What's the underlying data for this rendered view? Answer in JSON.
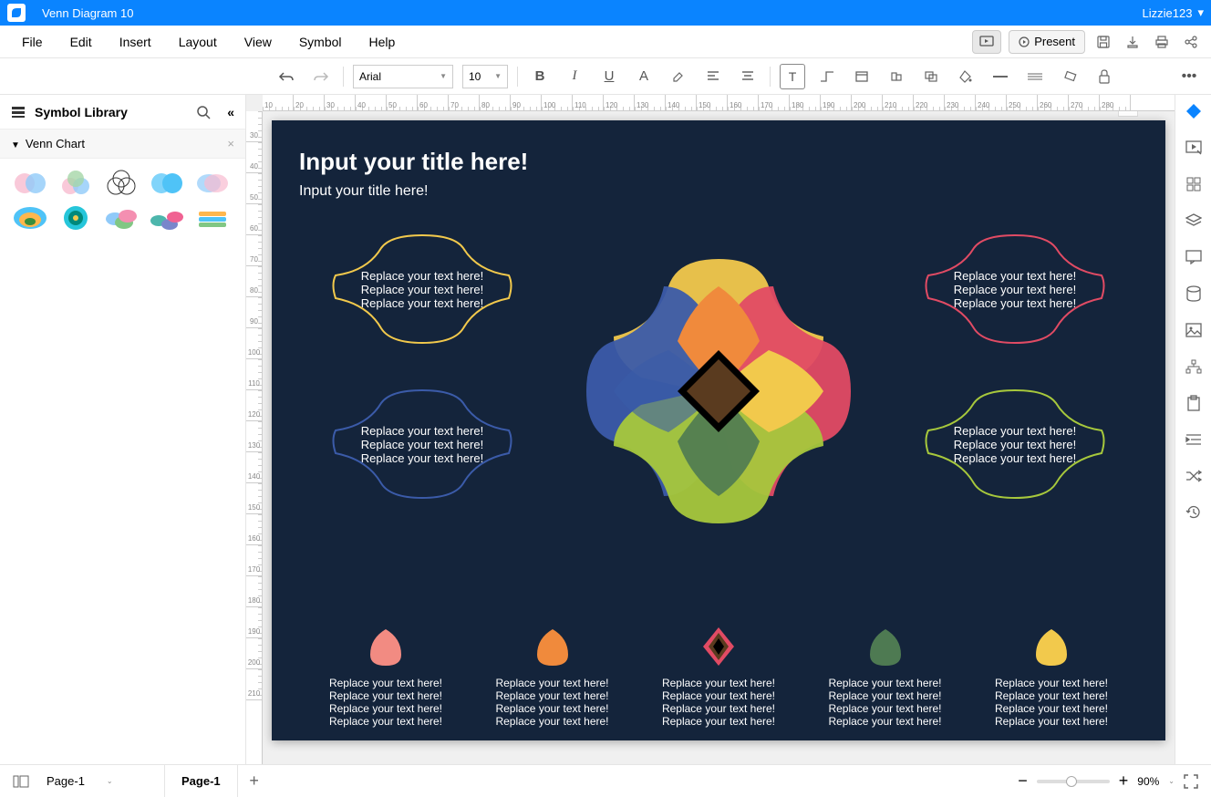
{
  "app": {
    "title": "Venn Diagram 10",
    "user": "Lizzie123"
  },
  "menu": {
    "items": [
      "File",
      "Edit",
      "Insert",
      "Layout",
      "View",
      "Symbol",
      "Help"
    ],
    "present": "Present"
  },
  "toolbar": {
    "font": "Arial",
    "size": "10"
  },
  "sidebar": {
    "title": "Symbol Library",
    "panel": "Venn Chart"
  },
  "page": {
    "title": "Input your title here!",
    "subtitle": "Input your title here!",
    "callout_text": "Replace your text here!   Replace your text here!   Replace your text here!",
    "legend_text": "Replace your text here!   Replace your text here!   Replace your text here!   Replace your text here!",
    "colors": {
      "orange": "#f08a3c",
      "blue": "#3b5ba9",
      "red": "#e14b64",
      "yellow": "#f2c94c",
      "green": "#a7c83c",
      "darkgreen": "#4e7a52",
      "coral": "#f28b82"
    }
  },
  "status": {
    "page_label": "Page-1",
    "tab": "Page-1",
    "zoom": "90%"
  },
  "ruler_h": [
    "10",
    "20",
    "30",
    "40",
    "50",
    "60",
    "70",
    "80",
    "90",
    "100",
    "110",
    "120",
    "130",
    "140",
    "150",
    "160",
    "170",
    "180",
    "190",
    "200",
    "210",
    "220",
    "230",
    "240",
    "250",
    "260",
    "270",
    "280"
  ],
  "ruler_v": [
    "30",
    "40",
    "50",
    "60",
    "70",
    "80",
    "90",
    "100",
    "110",
    "120",
    "130",
    "140",
    "150",
    "160",
    "170",
    "180",
    "190",
    "200",
    "210"
  ]
}
